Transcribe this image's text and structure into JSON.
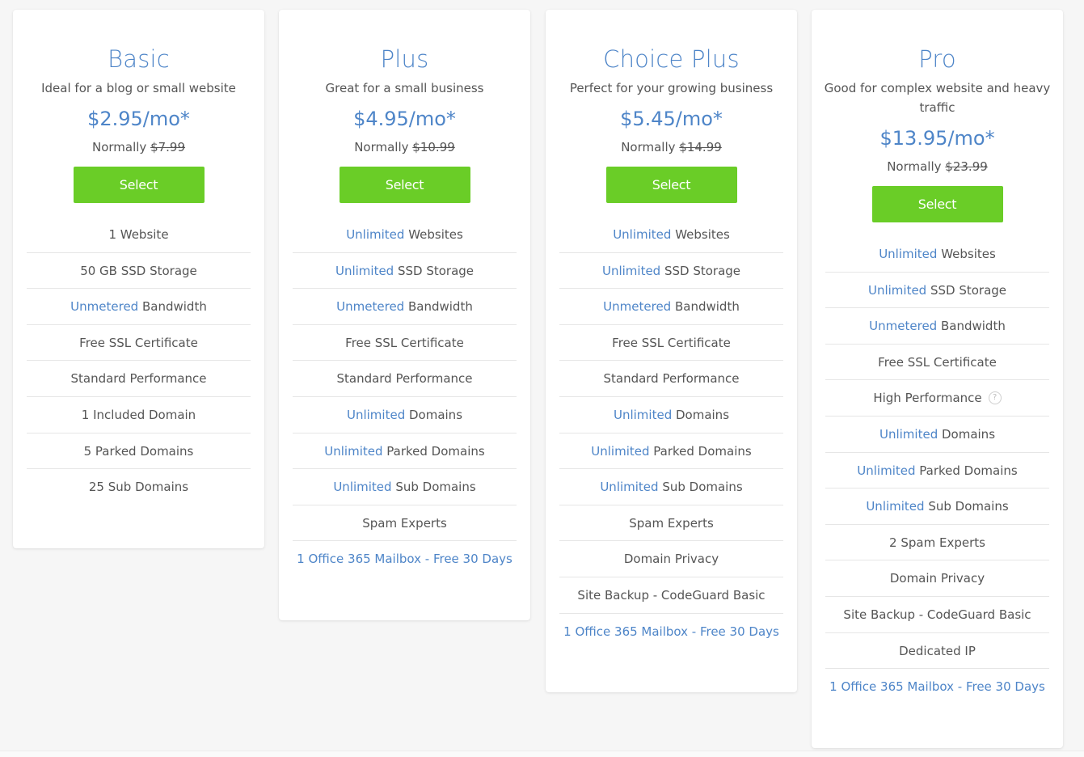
{
  "plans": [
    {
      "name": "Basic",
      "description": "Ideal for a blog or small website",
      "price": "$2.95/mo*",
      "normally_label": "Normally",
      "normal_price": "$7.99",
      "select_label": "Select",
      "features": [
        {
          "highlight": "",
          "text": "1 Website"
        },
        {
          "highlight": "",
          "text": "50 GB SSD Storage"
        },
        {
          "highlight": "Unmetered",
          "text": " Bandwidth"
        },
        {
          "highlight": "",
          "text": "Free SSL Certificate"
        },
        {
          "highlight": "",
          "text": "Standard Performance"
        },
        {
          "highlight": "",
          "text": "1 Included Domain"
        },
        {
          "highlight": "",
          "text": "5 Parked Domains"
        },
        {
          "highlight": "",
          "text": "25 Sub Domains"
        }
      ]
    },
    {
      "name": "Plus",
      "description": "Great for a small business",
      "price": "$4.95/mo*",
      "normally_label": "Normally",
      "normal_price": "$10.99",
      "select_label": "Select",
      "features": [
        {
          "highlight": "Unlimited",
          "text": " Websites"
        },
        {
          "highlight": "Unlimited",
          "text": " SSD Storage"
        },
        {
          "highlight": "Unmetered",
          "text": " Bandwidth"
        },
        {
          "highlight": "",
          "text": "Free SSL Certificate"
        },
        {
          "highlight": "",
          "text": "Standard Performance"
        },
        {
          "highlight": "Unlimited",
          "text": " Domains"
        },
        {
          "highlight": "Unlimited",
          "text": " Parked Domains"
        },
        {
          "highlight": "Unlimited",
          "text": " Sub Domains"
        },
        {
          "highlight": "",
          "text": "Spam Experts"
        },
        {
          "highlight": "",
          "text": "",
          "link": "1 Office 365 Mailbox - Free 30 Days"
        }
      ]
    },
    {
      "name": "Choice Plus",
      "description": "Perfect for your growing business",
      "price": "$5.45/mo*",
      "normally_label": "Normally",
      "normal_price": "$14.99",
      "select_label": "Select",
      "features": [
        {
          "highlight": "Unlimited",
          "text": " Websites"
        },
        {
          "highlight": "Unlimited",
          "text": " SSD Storage"
        },
        {
          "highlight": "Unmetered",
          "text": " Bandwidth"
        },
        {
          "highlight": "",
          "text": "Free SSL Certificate"
        },
        {
          "highlight": "",
          "text": "Standard Performance"
        },
        {
          "highlight": "Unlimited",
          "text": " Domains"
        },
        {
          "highlight": "Unlimited",
          "text": " Parked Domains"
        },
        {
          "highlight": "Unlimited",
          "text": " Sub Domains"
        },
        {
          "highlight": "",
          "text": "Spam Experts"
        },
        {
          "highlight": "",
          "text": "Domain Privacy"
        },
        {
          "highlight": "",
          "text": "Site Backup - CodeGuard Basic"
        },
        {
          "highlight": "",
          "text": "",
          "link": "1 Office 365 Mailbox - Free 30 Days"
        }
      ]
    },
    {
      "name": "Pro",
      "description": "Good for complex website and heavy traffic",
      "price": "$13.95/mo*",
      "normally_label": "Normally",
      "normal_price": "$23.99",
      "select_label": "Select",
      "features": [
        {
          "highlight": "Unlimited",
          "text": " Websites"
        },
        {
          "highlight": "Unlimited",
          "text": " SSD Storage"
        },
        {
          "highlight": "Unmetered",
          "text": " Bandwidth"
        },
        {
          "highlight": "",
          "text": "Free SSL Certificate"
        },
        {
          "highlight": "",
          "text": "High Performance",
          "help_icon": "?"
        },
        {
          "highlight": "Unlimited",
          "text": " Domains"
        },
        {
          "highlight": "Unlimited",
          "text": " Parked Domains"
        },
        {
          "highlight": "Unlimited",
          "text": " Sub Domains"
        },
        {
          "highlight": "",
          "text": "2 Spam Experts"
        },
        {
          "highlight": "",
          "text": "Domain Privacy"
        },
        {
          "highlight": "",
          "text": "Site Backup - CodeGuard Basic"
        },
        {
          "highlight": "",
          "text": "Dedicated IP"
        },
        {
          "highlight": "",
          "text": "",
          "link": "1 Office 365 Mailbox - Free 30 Days"
        }
      ]
    }
  ],
  "colors": {
    "accent_blue": "#4e85c8",
    "select_green": "#6acd27",
    "text_gray": "#555555",
    "background": "#f6f6f6"
  }
}
